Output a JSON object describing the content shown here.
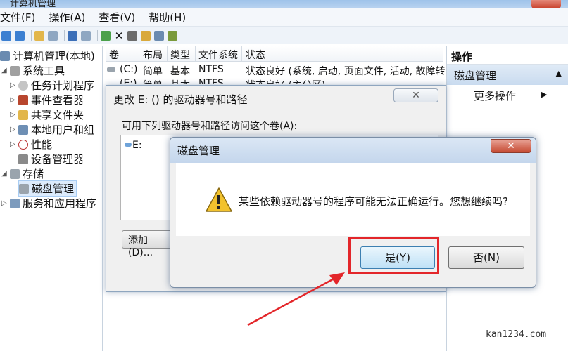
{
  "window": {
    "title": "计算机管理"
  },
  "menu": [
    "文件(F)",
    "操作(A)",
    "查看(V)",
    "帮助(H)"
  ],
  "tree": {
    "root": "计算机管理(本地)",
    "system_tools": "系统工具",
    "task_scheduler": "任务计划程序",
    "event_viewer": "事件查看器",
    "shared_folders": "共享文件夹",
    "local_users": "本地用户和组",
    "performance": "性能",
    "device_manager": "设备管理器",
    "storage": "存储",
    "disk_management": "磁盘管理",
    "services_apps": "服务和应用程序"
  },
  "list": {
    "headers": [
      "卷",
      "布局",
      "类型",
      "文件系统",
      "状态"
    ],
    "rows": [
      {
        "vol": "(C:)",
        "layout": "简单",
        "type": "基本",
        "fs": "NTFS",
        "status": "状态良好 (系统, 启动, 页面文件, 活动, 故障转"
      },
      {
        "vol": "(E:)",
        "layout": "简单",
        "type": "基本",
        "fs": "NTFS",
        "status": "状态良好 (主分区)"
      }
    ]
  },
  "actions": {
    "title": "操作",
    "section": "磁盘管理",
    "more": "更多操作"
  },
  "change_dialog": {
    "title": "更改 E: () 的驱动器号和路径",
    "label": "可用下列驱动器号和路径访问这个卷(A):",
    "entry": "E:",
    "add_button": "添加(D)...",
    "close_glyph": "✕"
  },
  "confirm_dialog": {
    "title": "磁盘管理",
    "message": "某些依赖驱动器号的程序可能无法正确运行。您想继续吗?",
    "yes_button": "是(Y)",
    "no_button": "否(N)",
    "close_glyph": "✕"
  },
  "watermark": "kan1234.com",
  "colors": {
    "highlight": "#e3262a",
    "selection": "#dcebfc"
  }
}
